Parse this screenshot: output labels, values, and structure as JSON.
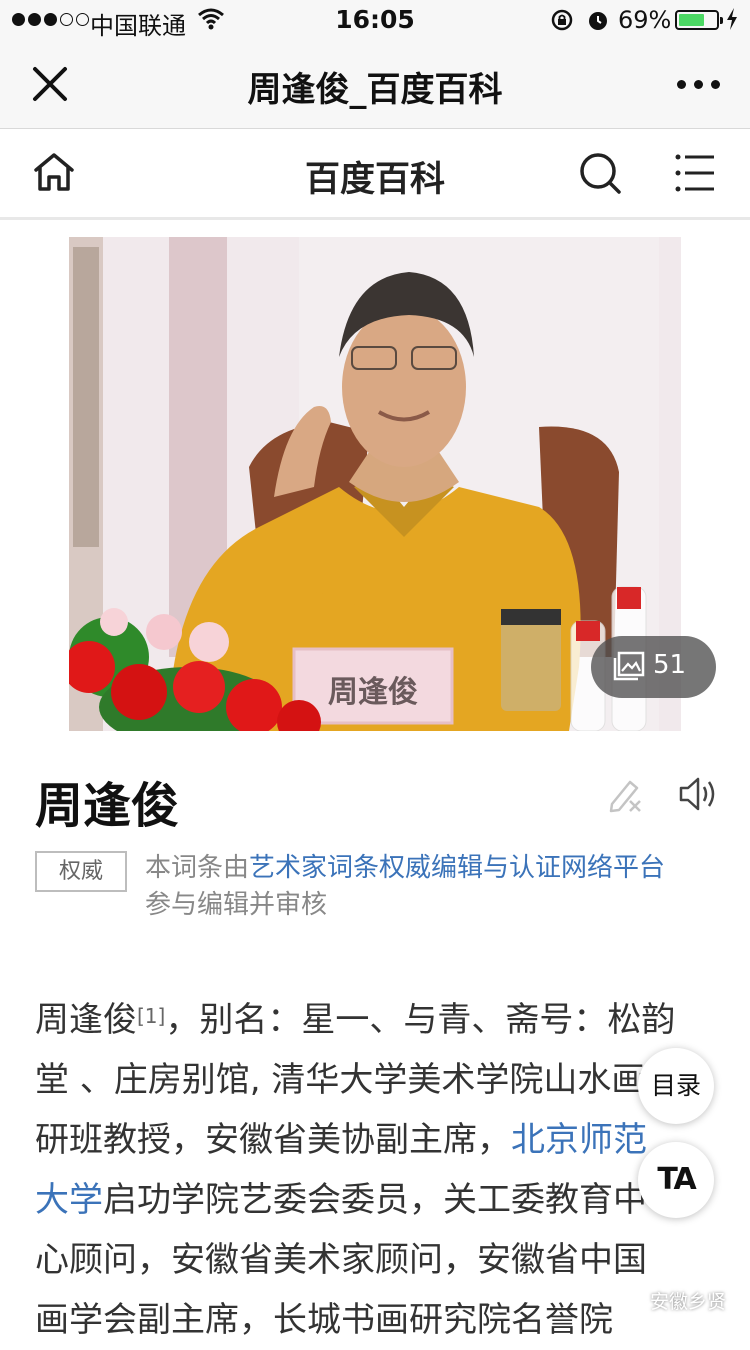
{
  "status_bar": {
    "carrier": "中国联通",
    "time": "16:05",
    "battery_percent": "69%",
    "battery_level": 0.69,
    "signal_bars": 3,
    "battery_color": "#4cd964"
  },
  "nav": {
    "close_icon": "close-icon",
    "title": "周逢俊_百度百科",
    "more_icon": "more-icon"
  },
  "baike_header": {
    "home_icon": "home-icon",
    "title": "百度百科",
    "search_icon": "search-icon",
    "menu_icon": "menu-icon"
  },
  "photo": {
    "nameplate": "周逢俊",
    "gallery_count": "51"
  },
  "entry": {
    "title": "周逢俊",
    "authority_badge": "权威",
    "authority_prefix": "本词条由",
    "authority_link": "艺术家词条权威编辑与认证网络平台",
    "authority_suffix": "参与编辑并审核"
  },
  "body": {
    "l1_a": "周逢俊",
    "l1_ref": "[1]",
    "l1_b": "，别名：星一、与青、斋号：松韵",
    "l2": "堂 、庄房别馆, 清华大学美术学院山水画高",
    "l3_a": "研班教授，安徽省美协副主席，",
    "l3_link": "北京师范",
    "l4_link": "大学",
    "l4_b": "启功学院艺委会委员，关工委教育中",
    "l5": "心顾问，安徽省美术家顾问，安徽省中国",
    "l6": "画学会副主席，长城书画研究院名誉院"
  },
  "floating": {
    "toc": "目录",
    "ta": "TA"
  },
  "watermark": "安徽乡贤",
  "colors": {
    "link": "#3b73b9",
    "bar_bg": "#f7f7f7"
  }
}
